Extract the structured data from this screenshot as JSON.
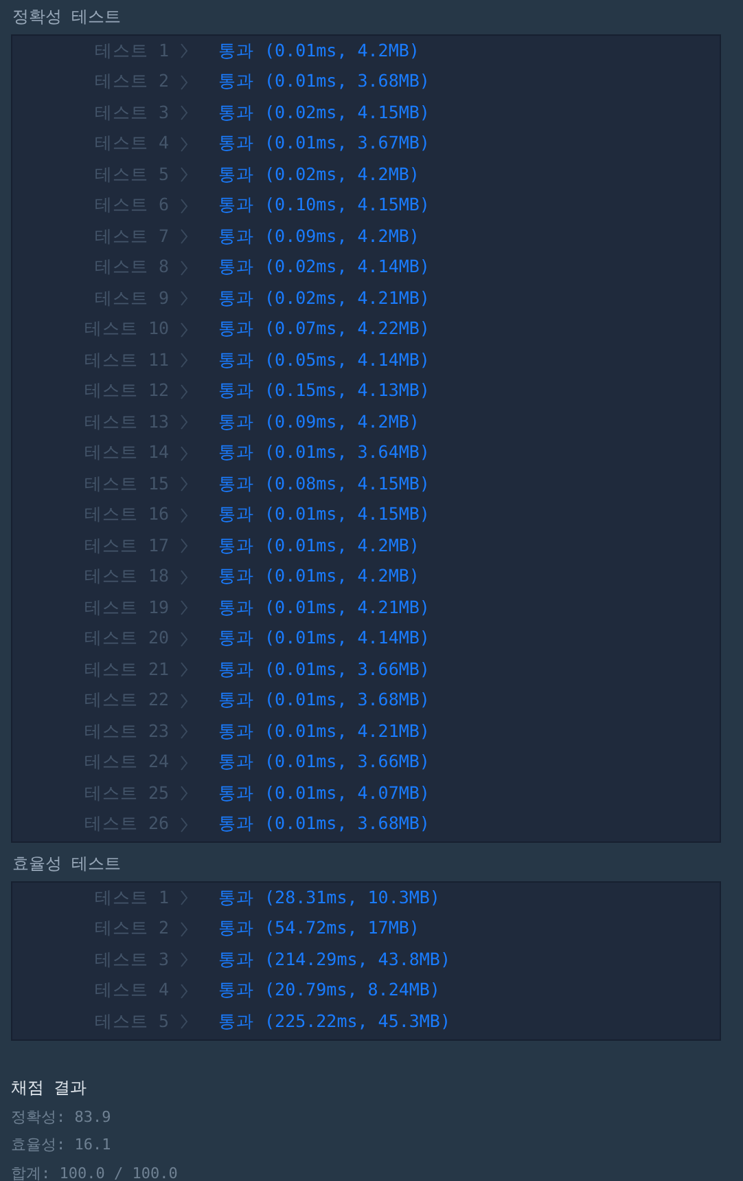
{
  "sections": [
    {
      "title": "정확성  테스트",
      "rows": [
        {
          "label": "테스트 1",
          "result": "통과 (0.01ms, 4.2MB)"
        },
        {
          "label": "테스트 2",
          "result": "통과 (0.01ms, 3.68MB)"
        },
        {
          "label": "테스트 3",
          "result": "통과 (0.02ms, 4.15MB)"
        },
        {
          "label": "테스트 4",
          "result": "통과 (0.01ms, 3.67MB)"
        },
        {
          "label": "테스트 5",
          "result": "통과 (0.02ms, 4.2MB)"
        },
        {
          "label": "테스트 6",
          "result": "통과 (0.10ms, 4.15MB)"
        },
        {
          "label": "테스트 7",
          "result": "통과 (0.09ms, 4.2MB)"
        },
        {
          "label": "테스트 8",
          "result": "통과 (0.02ms, 4.14MB)"
        },
        {
          "label": "테스트 9",
          "result": "통과 (0.02ms, 4.21MB)"
        },
        {
          "label": "테스트 10",
          "result": "통과 (0.07ms, 4.22MB)"
        },
        {
          "label": "테스트 11",
          "result": "통과 (0.05ms, 4.14MB)"
        },
        {
          "label": "테스트 12",
          "result": "통과 (0.15ms, 4.13MB)"
        },
        {
          "label": "테스트 13",
          "result": "통과 (0.09ms, 4.2MB)"
        },
        {
          "label": "테스트 14",
          "result": "통과 (0.01ms, 3.64MB)"
        },
        {
          "label": "테스트 15",
          "result": "통과 (0.08ms, 4.15MB)"
        },
        {
          "label": "테스트 16",
          "result": "통과 (0.01ms, 4.15MB)"
        },
        {
          "label": "테스트 17",
          "result": "통과 (0.01ms, 4.2MB)"
        },
        {
          "label": "테스트 18",
          "result": "통과 (0.01ms, 4.2MB)"
        },
        {
          "label": "테스트 19",
          "result": "통과 (0.01ms, 4.21MB)"
        },
        {
          "label": "테스트 20",
          "result": "통과 (0.01ms, 4.14MB)"
        },
        {
          "label": "테스트 21",
          "result": "통과 (0.01ms, 3.66MB)"
        },
        {
          "label": "테스트 22",
          "result": "통과 (0.01ms, 3.68MB)"
        },
        {
          "label": "테스트 23",
          "result": "통과 (0.01ms, 4.21MB)"
        },
        {
          "label": "테스트 24",
          "result": "통과 (0.01ms, 3.66MB)"
        },
        {
          "label": "테스트 25",
          "result": "통과 (0.01ms, 4.07MB)"
        },
        {
          "label": "테스트 26",
          "result": "통과 (0.01ms, 3.68MB)"
        }
      ]
    },
    {
      "title": "효율성  테스트",
      "rows": [
        {
          "label": "테스트 1",
          "result": "통과 (28.31ms, 10.3MB)"
        },
        {
          "label": "테스트 2",
          "result": "통과 (54.72ms, 17MB)"
        },
        {
          "label": "테스트 3",
          "result": "통과 (214.29ms, 43.8MB)"
        },
        {
          "label": "테스트 4",
          "result": "통과 (20.79ms, 8.24MB)"
        },
        {
          "label": "테스트 5",
          "result": "통과 (225.22ms, 45.3MB)"
        }
      ]
    }
  ],
  "summary": {
    "title": "채점 결과",
    "lines": [
      "정확성: 83.9",
      "효율성: 16.1",
      "합계: 100.0 / 100.0"
    ]
  }
}
